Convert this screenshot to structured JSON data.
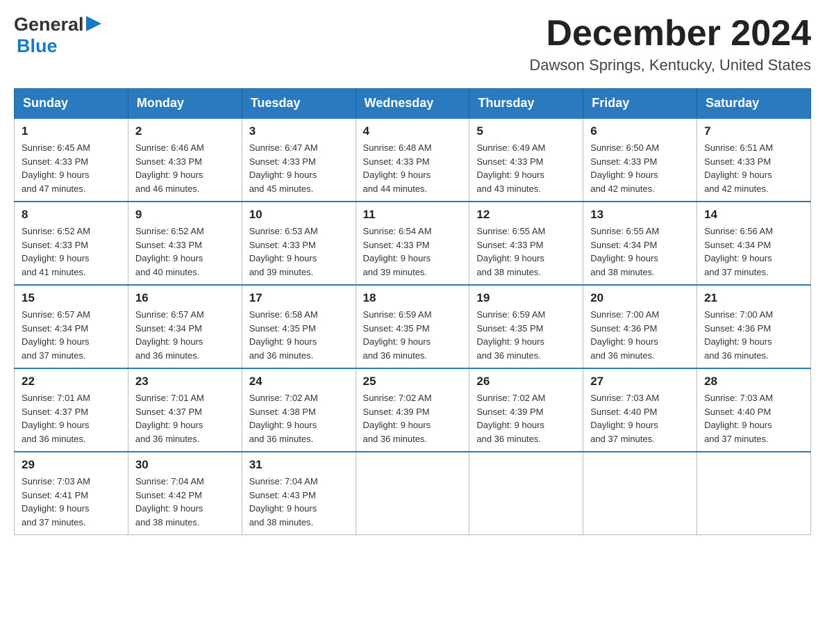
{
  "header": {
    "logo_general": "General",
    "logo_blue": "Blue",
    "month_title": "December 2024",
    "location": "Dawson Springs, Kentucky, United States"
  },
  "days_of_week": [
    "Sunday",
    "Monday",
    "Tuesday",
    "Wednesday",
    "Thursday",
    "Friday",
    "Saturday"
  ],
  "weeks": [
    [
      {
        "day": "1",
        "sunrise": "6:45 AM",
        "sunset": "4:33 PM",
        "daylight": "9 hours and 47 minutes."
      },
      {
        "day": "2",
        "sunrise": "6:46 AM",
        "sunset": "4:33 PM",
        "daylight": "9 hours and 46 minutes."
      },
      {
        "day": "3",
        "sunrise": "6:47 AM",
        "sunset": "4:33 PM",
        "daylight": "9 hours and 45 minutes."
      },
      {
        "day": "4",
        "sunrise": "6:48 AM",
        "sunset": "4:33 PM",
        "daylight": "9 hours and 44 minutes."
      },
      {
        "day": "5",
        "sunrise": "6:49 AM",
        "sunset": "4:33 PM",
        "daylight": "9 hours and 43 minutes."
      },
      {
        "day": "6",
        "sunrise": "6:50 AM",
        "sunset": "4:33 PM",
        "daylight": "9 hours and 42 minutes."
      },
      {
        "day": "7",
        "sunrise": "6:51 AM",
        "sunset": "4:33 PM",
        "daylight": "9 hours and 42 minutes."
      }
    ],
    [
      {
        "day": "8",
        "sunrise": "6:52 AM",
        "sunset": "4:33 PM",
        "daylight": "9 hours and 41 minutes."
      },
      {
        "day": "9",
        "sunrise": "6:52 AM",
        "sunset": "4:33 PM",
        "daylight": "9 hours and 40 minutes."
      },
      {
        "day": "10",
        "sunrise": "6:53 AM",
        "sunset": "4:33 PM",
        "daylight": "9 hours and 39 minutes."
      },
      {
        "day": "11",
        "sunrise": "6:54 AM",
        "sunset": "4:33 PM",
        "daylight": "9 hours and 39 minutes."
      },
      {
        "day": "12",
        "sunrise": "6:55 AM",
        "sunset": "4:33 PM",
        "daylight": "9 hours and 38 minutes."
      },
      {
        "day": "13",
        "sunrise": "6:55 AM",
        "sunset": "4:34 PM",
        "daylight": "9 hours and 38 minutes."
      },
      {
        "day": "14",
        "sunrise": "6:56 AM",
        "sunset": "4:34 PM",
        "daylight": "9 hours and 37 minutes."
      }
    ],
    [
      {
        "day": "15",
        "sunrise": "6:57 AM",
        "sunset": "4:34 PM",
        "daylight": "9 hours and 37 minutes."
      },
      {
        "day": "16",
        "sunrise": "6:57 AM",
        "sunset": "4:34 PM",
        "daylight": "9 hours and 36 minutes."
      },
      {
        "day": "17",
        "sunrise": "6:58 AM",
        "sunset": "4:35 PM",
        "daylight": "9 hours and 36 minutes."
      },
      {
        "day": "18",
        "sunrise": "6:59 AM",
        "sunset": "4:35 PM",
        "daylight": "9 hours and 36 minutes."
      },
      {
        "day": "19",
        "sunrise": "6:59 AM",
        "sunset": "4:35 PM",
        "daylight": "9 hours and 36 minutes."
      },
      {
        "day": "20",
        "sunrise": "7:00 AM",
        "sunset": "4:36 PM",
        "daylight": "9 hours and 36 minutes."
      },
      {
        "day": "21",
        "sunrise": "7:00 AM",
        "sunset": "4:36 PM",
        "daylight": "9 hours and 36 minutes."
      }
    ],
    [
      {
        "day": "22",
        "sunrise": "7:01 AM",
        "sunset": "4:37 PM",
        "daylight": "9 hours and 36 minutes."
      },
      {
        "day": "23",
        "sunrise": "7:01 AM",
        "sunset": "4:37 PM",
        "daylight": "9 hours and 36 minutes."
      },
      {
        "day": "24",
        "sunrise": "7:02 AM",
        "sunset": "4:38 PM",
        "daylight": "9 hours and 36 minutes."
      },
      {
        "day": "25",
        "sunrise": "7:02 AM",
        "sunset": "4:39 PM",
        "daylight": "9 hours and 36 minutes."
      },
      {
        "day": "26",
        "sunrise": "7:02 AM",
        "sunset": "4:39 PM",
        "daylight": "9 hours and 36 minutes."
      },
      {
        "day": "27",
        "sunrise": "7:03 AM",
        "sunset": "4:40 PM",
        "daylight": "9 hours and 37 minutes."
      },
      {
        "day": "28",
        "sunrise": "7:03 AM",
        "sunset": "4:40 PM",
        "daylight": "9 hours and 37 minutes."
      }
    ],
    [
      {
        "day": "29",
        "sunrise": "7:03 AM",
        "sunset": "4:41 PM",
        "daylight": "9 hours and 37 minutes."
      },
      {
        "day": "30",
        "sunrise": "7:04 AM",
        "sunset": "4:42 PM",
        "daylight": "9 hours and 38 minutes."
      },
      {
        "day": "31",
        "sunrise": "7:04 AM",
        "sunset": "4:43 PM",
        "daylight": "9 hours and 38 minutes."
      },
      null,
      null,
      null,
      null
    ]
  ],
  "labels": {
    "sunrise": "Sunrise:",
    "sunset": "Sunset:",
    "daylight": "Daylight:"
  }
}
